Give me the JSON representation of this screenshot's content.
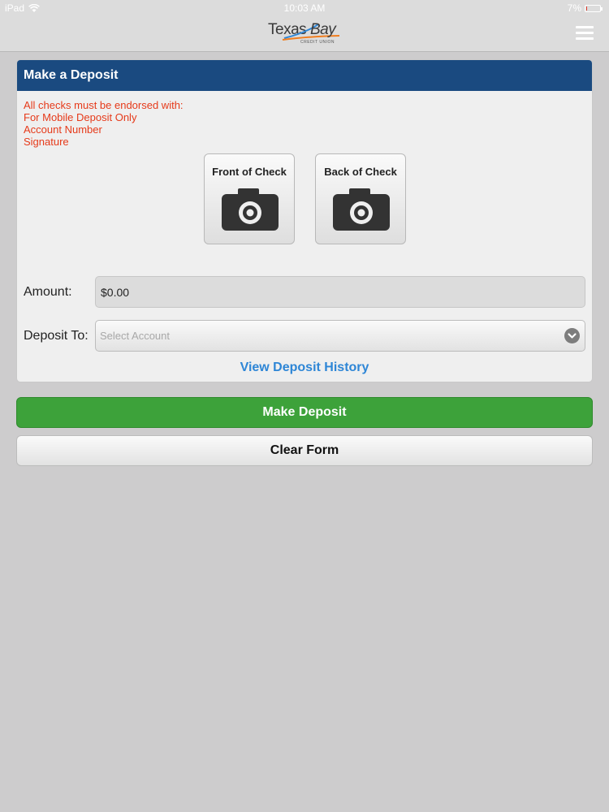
{
  "status_bar": {
    "device": "iPad",
    "time": "10:03 AM",
    "battery": "7%",
    "battery_level": 0.07
  },
  "header": {
    "logo_word1": "Texas",
    "logo_word2": "Bay",
    "logo_sub": "CREDIT UNION"
  },
  "card": {
    "title": "Make a Deposit",
    "instructions": [
      "All checks must be endorsed with:",
      "For Mobile Deposit Only",
      "Account Number",
      "Signature"
    ],
    "front_label": "Front of Check",
    "back_label": "Back of Check",
    "amount_label": "Amount:",
    "amount_value": "$0.00",
    "deposit_to_label": "Deposit To:",
    "select_placeholder": "Select Account",
    "history_link": "View Deposit History"
  },
  "buttons": {
    "make_deposit": "Make Deposit",
    "clear_form": "Clear Form"
  },
  "icons": {
    "menu": "hamburger-menu-icon",
    "camera": "camera-icon",
    "select": "chevron-down-icon",
    "wifi": "wifi-icon",
    "battery": "battery-icon"
  },
  "colors": {
    "header_bar": "#1a4a80",
    "instructions": "#e63a1a",
    "link": "#2e86d6",
    "deposit_button": "#3da23a"
  }
}
